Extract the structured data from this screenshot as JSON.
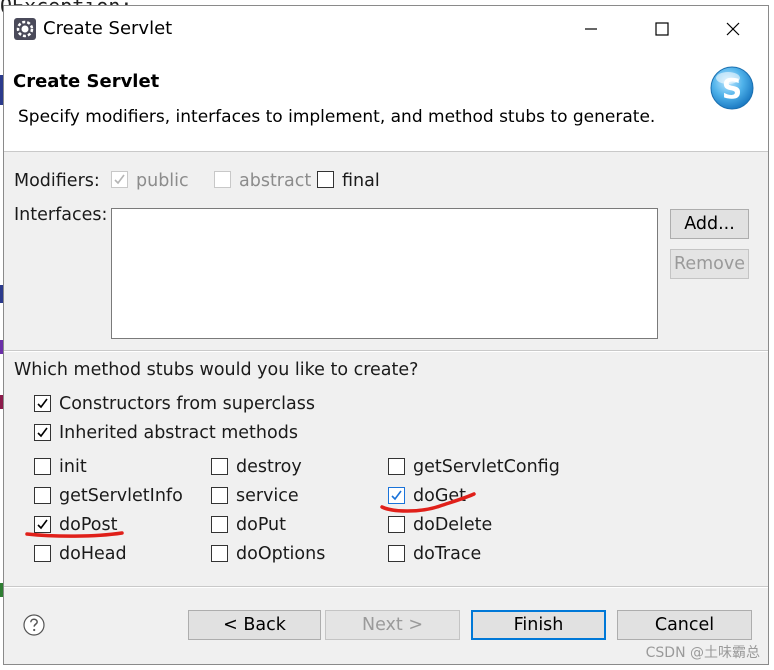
{
  "background": {
    "code_fragment": "OException;"
  },
  "titlebar": {
    "title": "Create Servlet",
    "app_icon": "gear-icon",
    "minimize": "minimize-icon",
    "maximize": "maximize-icon",
    "close": "close-icon"
  },
  "header": {
    "title": "Create Servlet",
    "description": "Specify modifiers, interfaces to implement, and method stubs to generate.",
    "logo_letter": "S"
  },
  "modifiers": {
    "label": "Modifiers:",
    "options": [
      {
        "label": "public",
        "checked": true,
        "enabled": false
      },
      {
        "label": "abstract",
        "checked": false,
        "enabled": false
      },
      {
        "label": "final",
        "checked": false,
        "enabled": true
      }
    ]
  },
  "interfaces": {
    "label": "Interfaces:",
    "add_label": "Add...",
    "remove_label": "Remove"
  },
  "stubs": {
    "question": "Which method stubs would you like to create?",
    "general": [
      {
        "label": "Constructors from superclass",
        "checked": true
      },
      {
        "label": "Inherited abstract methods",
        "checked": true
      }
    ],
    "methods": [
      {
        "label": "init",
        "checked": false
      },
      {
        "label": "destroy",
        "checked": false
      },
      {
        "label": "getServletConfig",
        "checked": false
      },
      {
        "label": "getServletInfo",
        "checked": false
      },
      {
        "label": "service",
        "checked": false
      },
      {
        "label": "doGet",
        "checked": true
      },
      {
        "label": "doPost",
        "checked": true
      },
      {
        "label": "doPut",
        "checked": false
      },
      {
        "label": "doDelete",
        "checked": false
      },
      {
        "label": "doHead",
        "checked": false
      },
      {
        "label": "doOptions",
        "checked": false
      },
      {
        "label": "doTrace",
        "checked": false
      }
    ]
  },
  "footer": {
    "help_icon": "help-icon",
    "back_label": "< Back",
    "next_label": "Next >",
    "finish_label": "Finish",
    "cancel_label": "Cancel"
  },
  "watermark": "CSDN @土味霸总",
  "colors": {
    "annotation_red": "#e0201a",
    "primary_border": "#0078d7",
    "check_blue": "#1a73d9"
  }
}
